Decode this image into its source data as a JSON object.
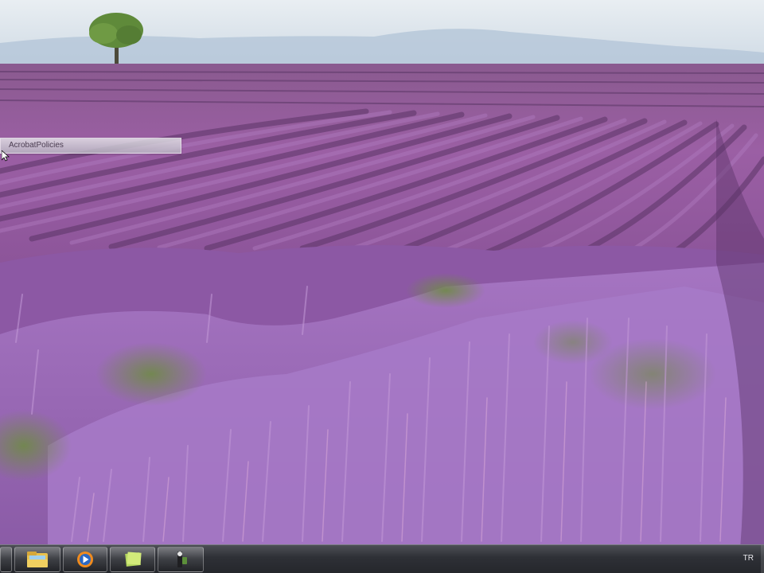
{
  "desktop": {
    "drag_label_text": "AcrobatPolicies"
  },
  "taskbar": {
    "pinned": [
      {
        "name": "explorer",
        "icon": "folder-icon"
      },
      {
        "name": "media-player",
        "icon": "media-player-icon"
      },
      {
        "name": "sticky-notes",
        "icon": "sticky-notes-icon"
      },
      {
        "name": "tools",
        "icon": "tools-icon"
      }
    ],
    "language": "TR"
  },
  "colors": {
    "sky": "#dde6ee",
    "lavender": "#9a62b4",
    "taskbar": "#2e3036"
  }
}
